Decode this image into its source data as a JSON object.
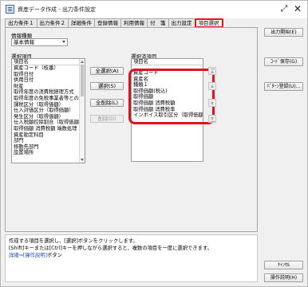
{
  "window": {
    "title": "資産データ作成 - 出力条件設定"
  },
  "tabs": [
    {
      "label": "出力条件１"
    },
    {
      "label": "出力条件２"
    },
    {
      "label": "詳細条件"
    },
    {
      "label": "登録情報"
    },
    {
      "label": "利用情報"
    },
    {
      "label": "付　箋"
    },
    {
      "label": "出力設定"
    },
    {
      "label": "項目選択"
    }
  ],
  "info_type": {
    "label": "情報種類",
    "value": "基本情報"
  },
  "available": {
    "label": "選択項目",
    "header": "項目名",
    "items": [
      "資産コード（枝番）",
      "取得日付",
      "供用日付",
      "財産",
      "取得年度の消費税経理方式",
      "取得年度の免税事業者等との取",
      "課税区分（取得価額）",
      "仕入対価区分（取得価額）",
      "発生区分（取得価額）",
      "仕入税額控除割合（取得価額）",
      "取得価額 消費税額 端数処理",
      "資産勘定科目",
      "部門",
      "移動先部門",
      "設置場所"
    ]
  },
  "selected": {
    "label": "選択済項目",
    "header": "項目名",
    "items": [
      "資産コード",
      "資産名",
      "種類１",
      "取得価額(税込)",
      "取得価額",
      "取得価額 消費税額",
      "取得価額 消費税率",
      "インボイス取引区分（取得価額）"
    ]
  },
  "buttons": {
    "select_all": "全選択(A)",
    "select": "選択(S)",
    "remove_all": "全削除(L)",
    "remove": "削除(D)"
  },
  "help": {
    "line1": "作成する項目を選択し、[選択]ボタンをクリックします。",
    "line2": "[Shift]キーまたは[Ctrl]キーを押しながら選択すると、複数の項目を一度に選択できます。",
    "line3_link": "詳細⇒[操作説明]",
    "line3_text": "ボタン"
  },
  "side": {
    "output_start": "出力開始(E)",
    "code_save": "ｺｰﾄﾞ保存(G)",
    "pattern_register": "ﾊﾟﾀｰﾝ登録(U)...",
    "cancel": "ｷｬﾝｾﾙ",
    "help": "操作説明(H)"
  },
  "colors": {
    "highlight": "#e0141e",
    "link": "#1a4fb5"
  }
}
